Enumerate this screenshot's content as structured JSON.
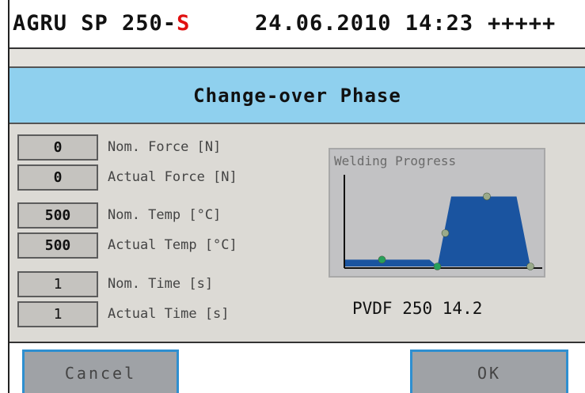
{
  "statusbar": {
    "model": "AGRU SP 250-",
    "model_suffix": "S",
    "datetime": "24.06.2010 14:23",
    "signal": "+++++"
  },
  "header": {
    "title": "Change-over Phase"
  },
  "parameters": [
    {
      "value": "0",
      "label": "Nom. Force [N]"
    },
    {
      "value": "0",
      "label": "Actual Force [N]"
    },
    {
      "value": "500",
      "label": "Nom. Temp [°C]"
    },
    {
      "value": "500",
      "label": "Actual Temp [°C]"
    },
    {
      "value": "1",
      "label": "Nom. Time [s]"
    },
    {
      "value": "1",
      "label": "Actual Time [s]"
    }
  ],
  "chart": {
    "title": "Welding Progress",
    "caption": "PVDF 250 14.2",
    "colors": {
      "fill": "#1a54a0",
      "marker_done": "#27a05a",
      "marker_pending": "#9aaa8a",
      "axis": "#111111"
    }
  },
  "chart_data": {
    "type": "area",
    "title": "Welding Progress",
    "xlabel": "",
    "ylabel": "",
    "xlim": [
      0,
      100
    ],
    "ylim": [
      0,
      100
    ],
    "series": [
      {
        "x": [
          0,
          43,
          47,
          54,
          87,
          94
        ],
        "y": [
          8,
          8,
          0,
          82,
          82,
          0
        ]
      }
    ],
    "markers": [
      {
        "x": 19,
        "y": 8,
        "state": "done"
      },
      {
        "x": 47,
        "y": 0,
        "state": "done"
      },
      {
        "x": 51,
        "y": 39,
        "state": "pending"
      },
      {
        "x": 72,
        "y": 82,
        "state": "pending"
      },
      {
        "x": 94,
        "y": 0,
        "state": "pending"
      }
    ]
  },
  "buttons": {
    "cancel": "Cancel",
    "ok": "OK"
  }
}
